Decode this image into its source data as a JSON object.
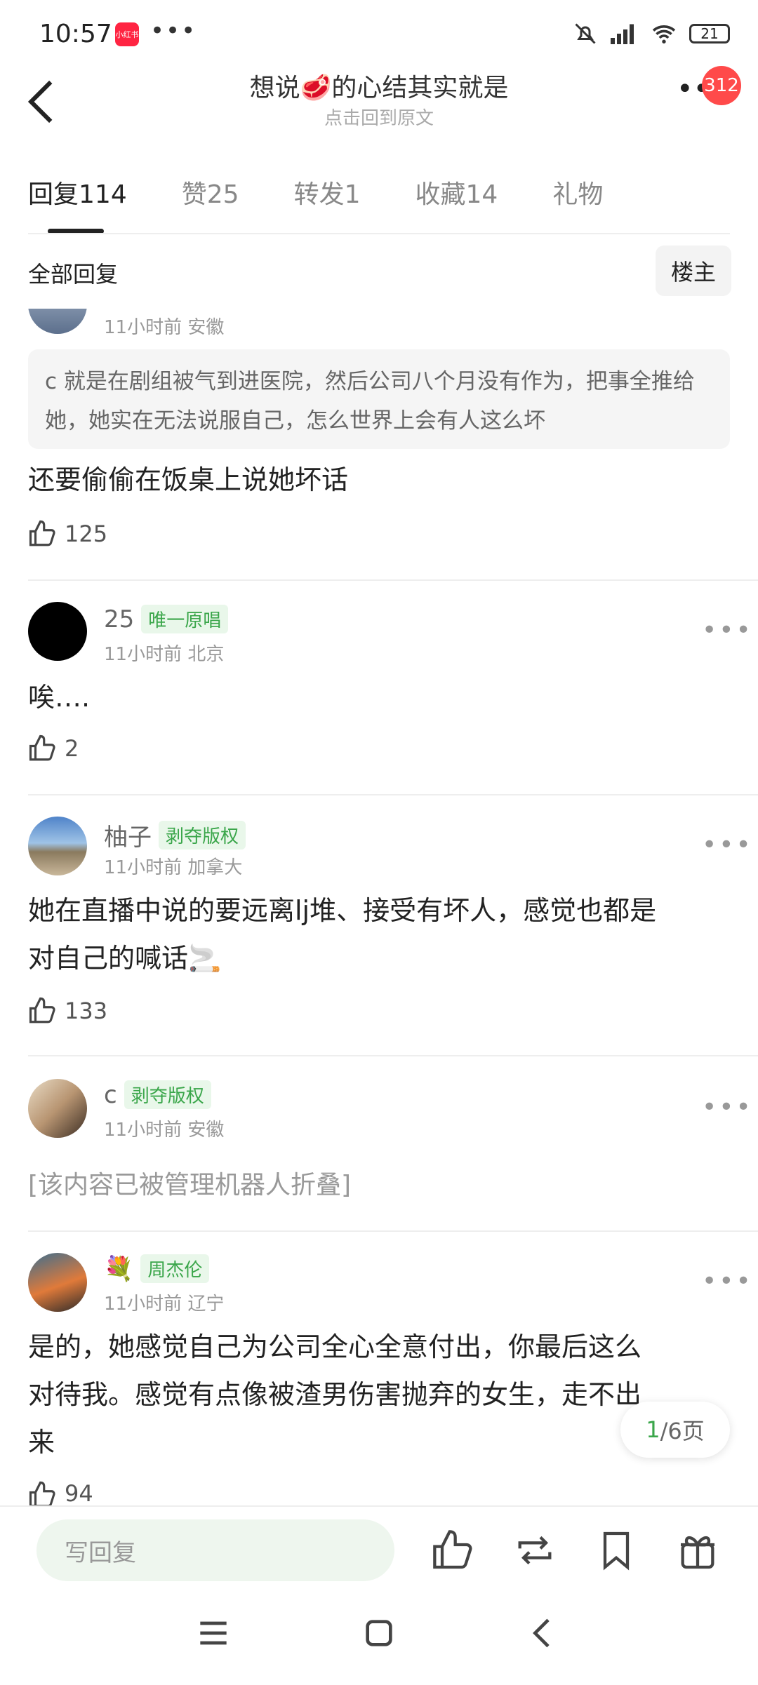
{
  "status": {
    "time": "10:57",
    "app_badge": "小红书",
    "dots": "•••",
    "battery": "21"
  },
  "header": {
    "title": "想说🥩的心结其实就是",
    "subtitle": "点击回到原文",
    "more": "••",
    "badge_count": "312"
  },
  "tabs": [
    {
      "label": "回复",
      "count": "114"
    },
    {
      "label": "赞",
      "count": "25"
    },
    {
      "label": "转发",
      "count": "1"
    },
    {
      "label": "收藏",
      "count": "14"
    },
    {
      "label": "礼物",
      "count": ""
    }
  ],
  "section": {
    "all_replies": "全部回复",
    "owner_filter": "楼主"
  },
  "comments": [
    {
      "name": "",
      "tag": "",
      "meta": "11小时前 安徽",
      "quote": "c 就是在剧组被气到进医院，然后公司八个月没有作为，把事全推给她，她实在无法说服自己，怎么世界上会有人这么坏",
      "body": "还要偷偷在饭桌上说她坏话",
      "likes": "125"
    },
    {
      "name": "25",
      "tag": "唯一原唱",
      "meta": "11小时前 北京",
      "body": "唉….",
      "likes": "2"
    },
    {
      "name": "柚子",
      "tag": "剥夺版权",
      "meta": "11小时前 加拿大",
      "body_line1": "她在直播中说的要远离lj堆、接受有坏人，感觉也都是",
      "body_line2": "对自己的喊话🚬",
      "likes": "133"
    },
    {
      "name": "c",
      "tag": "剥夺版权",
      "meta": "11小时前 安徽",
      "body": "[该内容已被管理机器人折叠]"
    },
    {
      "name": "💐",
      "tag": "周杰伦",
      "meta": "11小时前 辽宁",
      "body_line1": "是的，她感觉自己为公司全心全意付出，你最后这么",
      "body_line2": "对待我。感觉有点像被渣男伤害抛弃的女生，走不出",
      "body_line3": "来",
      "likes": "94"
    }
  ],
  "pager": {
    "current": "1",
    "rest": "/6页"
  },
  "bottom": {
    "reply_placeholder": "写回复"
  },
  "colors": {
    "accent_green": "#3aa64a",
    "badge_red": "#ff4a4a"
  }
}
